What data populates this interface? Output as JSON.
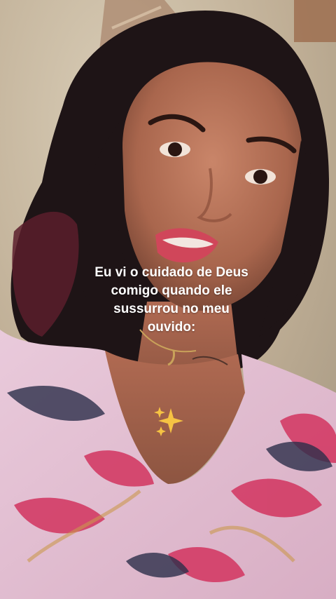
{
  "overlay": {
    "caption_lines": [
      "Eu vi o cuidado de Deus",
      "comigo quando ele",
      "sussurrou no meu",
      "ouvido:"
    ],
    "emoji_icon": "sparkles-icon"
  },
  "colors": {
    "caption_text": "#ffffff",
    "sparkle": "#f6c343",
    "background_wall": "#cdbfa8",
    "hair": "#1e1416",
    "skin": "#b9735a",
    "lips": "#d0465a",
    "blouse_base": "#e6c3d6",
    "blouse_leaf_pink": "#d2345f",
    "blouse_leaf_dark": "#2c2e4a"
  }
}
